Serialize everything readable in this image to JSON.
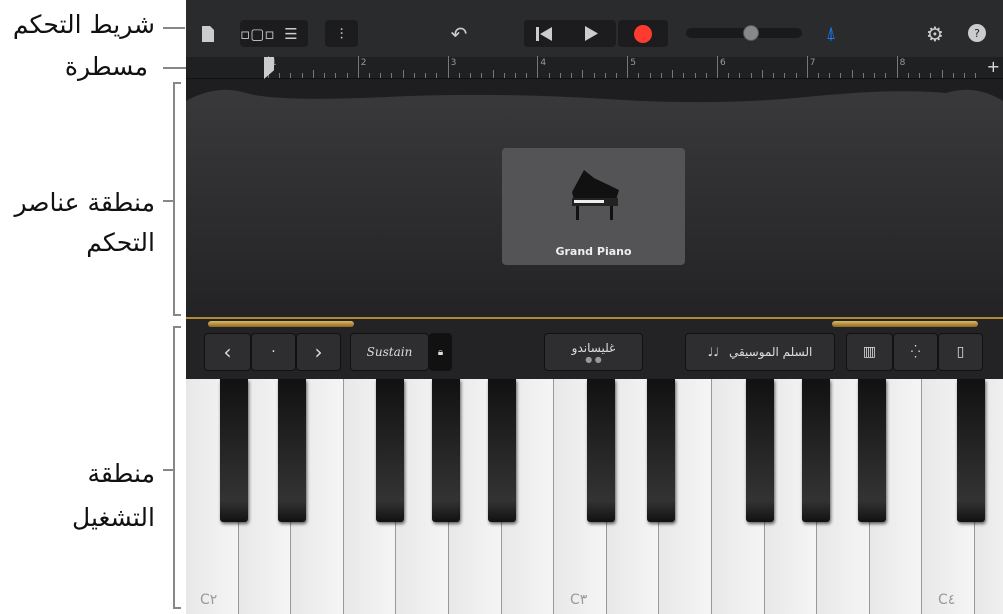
{
  "callouts": {
    "control_bar": "شريط التحكم",
    "ruler": "مسطرة",
    "controls_area_1": "منطقة عناصر",
    "controls_area_2": "التحكم",
    "play_area_1": "منطقة",
    "play_area_2": "التشغيل"
  },
  "toolbar": {
    "icons": [
      "document-icon",
      "view-toggle-icon",
      "tracks-icon",
      "mixer-icon",
      "undo-icon",
      "rewind-icon",
      "play-icon",
      "record-icon",
      "volume-slider",
      "metronome-icon",
      "settings-icon",
      "help-icon"
    ],
    "volume": 0.6,
    "record_color": "#ff3b30",
    "metronome_color": "#1a7cf5"
  },
  "ruler": {
    "bars": [
      "1",
      "2",
      "3",
      "4",
      "5",
      "6",
      "7",
      "8"
    ],
    "add": "+"
  },
  "instrument": {
    "name": "Grand Piano"
  },
  "strip": {
    "octave_down": "‹",
    "octave_center": "·",
    "octave_up": "›",
    "sustain": "Sustain",
    "glissando": "غليساندو",
    "scale": "السلم الموسيقي",
    "scale_icon": "♩♩"
  },
  "keys": {
    "labels": [
      "C٢",
      "C٣",
      "C٤"
    ]
  }
}
